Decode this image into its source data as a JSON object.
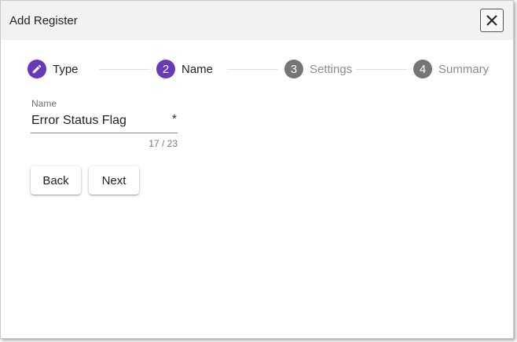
{
  "dialog": {
    "title": "Add Register",
    "close_icon": "close-icon"
  },
  "stepper": {
    "steps": [
      {
        "number": "",
        "label": "Type",
        "state": "completed",
        "icon": "pencil-icon"
      },
      {
        "number": "2",
        "label": "Name",
        "state": "active"
      },
      {
        "number": "3",
        "label": "Settings",
        "state": "inactive"
      },
      {
        "number": "4",
        "label": "Summary",
        "state": "inactive"
      }
    ]
  },
  "form": {
    "name_label": "Name",
    "name_value": "Error Status Flag",
    "required_mark": "*",
    "char_counter": "17 / 23"
  },
  "actions": {
    "back_label": "Back",
    "next_label": "Next"
  },
  "colors": {
    "accent": "#673ab7",
    "inactive_step": "#757575",
    "titlebar": "#f2f2f2"
  }
}
